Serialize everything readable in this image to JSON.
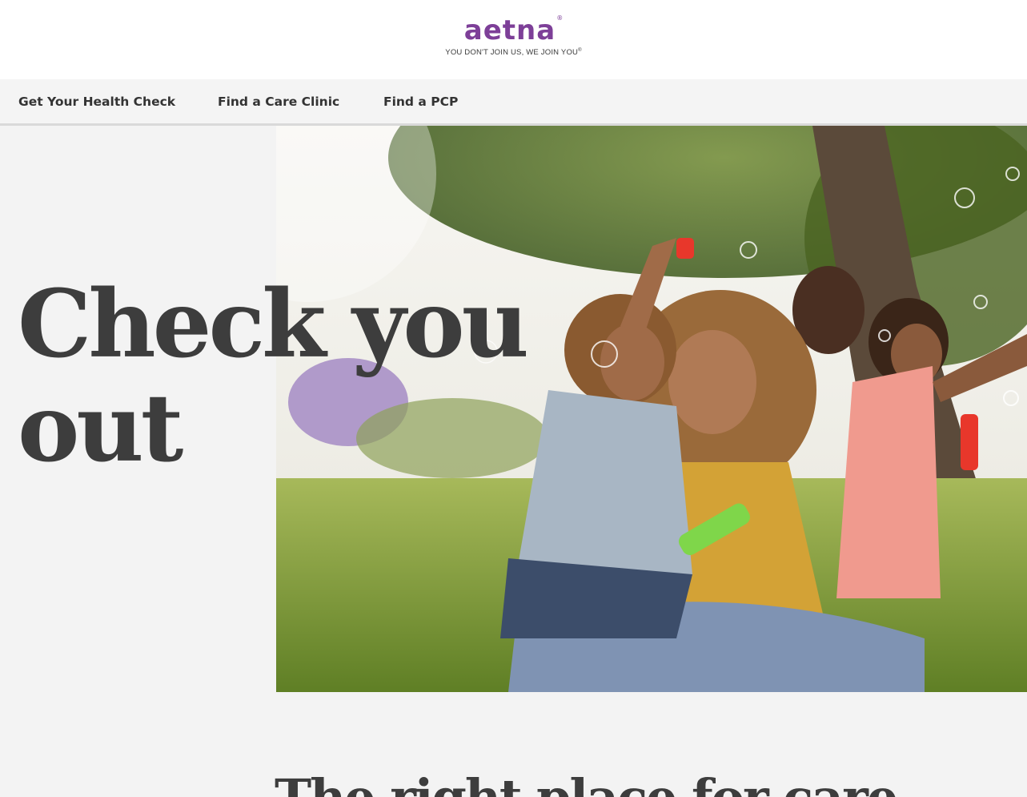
{
  "header": {
    "logo_text": "aetna",
    "logo_registered": "®",
    "tagline": "YOU DON'T JOIN US, WE JOIN YOU",
    "tagline_registered": "®",
    "brand_color": "#7d3f98"
  },
  "nav": {
    "items": [
      {
        "label": "Get Your Health Check"
      },
      {
        "label": "Find a Care Clinic"
      },
      {
        "label": "Find a PCP"
      }
    ]
  },
  "hero": {
    "headline_line1": "Check you",
    "headline_line2": "out",
    "image_subject": "family-blowing-bubbles-photo"
  },
  "section": {
    "title": "The right place for care"
  },
  "colors": {
    "page_background": "#f3f3f3",
    "text_dark": "#3d3d3d",
    "nav_border": "#d9d9d9"
  }
}
